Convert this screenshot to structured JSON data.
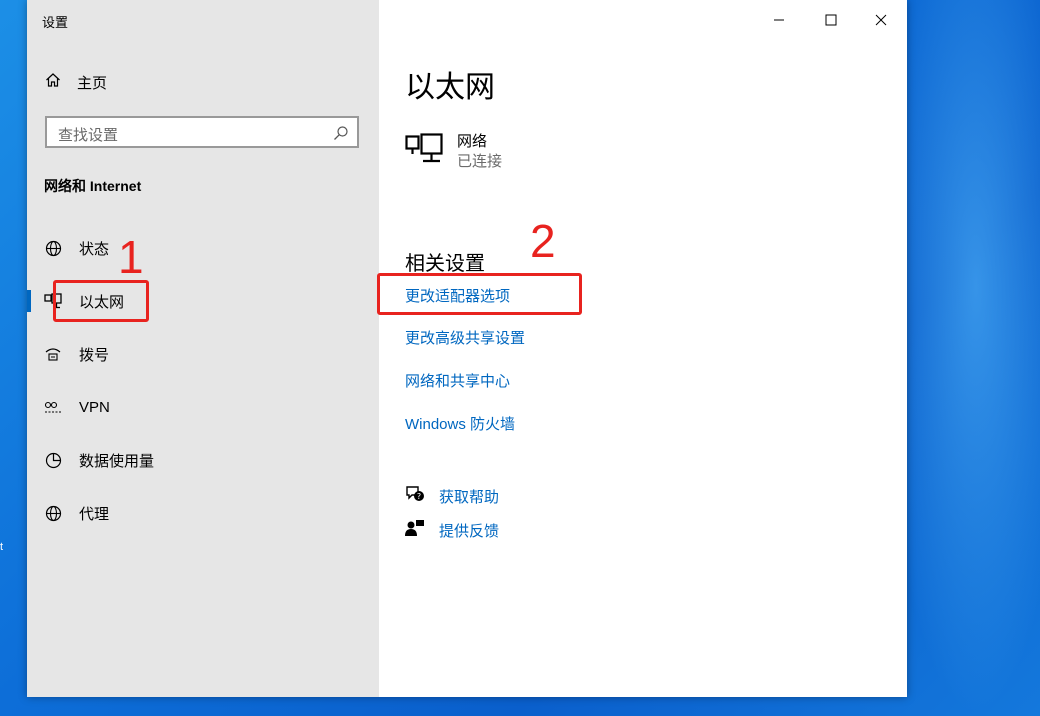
{
  "app": {
    "title": "设置"
  },
  "sidebar": {
    "home_label": "主页",
    "search_placeholder": "查找设置",
    "section_title": "网络和 Internet",
    "items": [
      {
        "label": "状态",
        "icon": "globe-status-icon"
      },
      {
        "label": "以太网",
        "icon": "ethernet-icon",
        "selected": true
      },
      {
        "label": "拨号",
        "icon": "dialup-icon"
      },
      {
        "label": "VPN",
        "icon": "vpn-icon"
      },
      {
        "label": "数据使用量",
        "icon": "data-usage-icon"
      },
      {
        "label": "代理",
        "icon": "globe-proxy-icon"
      }
    ]
  },
  "main": {
    "title": "以太网",
    "network": {
      "name": "网络",
      "status": "已连接"
    },
    "related_title": "相关设置",
    "related_links": [
      "更改适配器选项",
      "更改高级共享设置",
      "网络和共享中心",
      "Windows 防火墙"
    ],
    "help": {
      "get_help": "获取帮助",
      "feedback": "提供反馈"
    }
  },
  "annotations": {
    "step1": "1",
    "step2": "2",
    "color": "#e8231f"
  },
  "colors": {
    "accent": "#0067c0",
    "sidebar_bg": "#e6e6e6"
  },
  "desktop": {
    "edge_text": "t"
  }
}
